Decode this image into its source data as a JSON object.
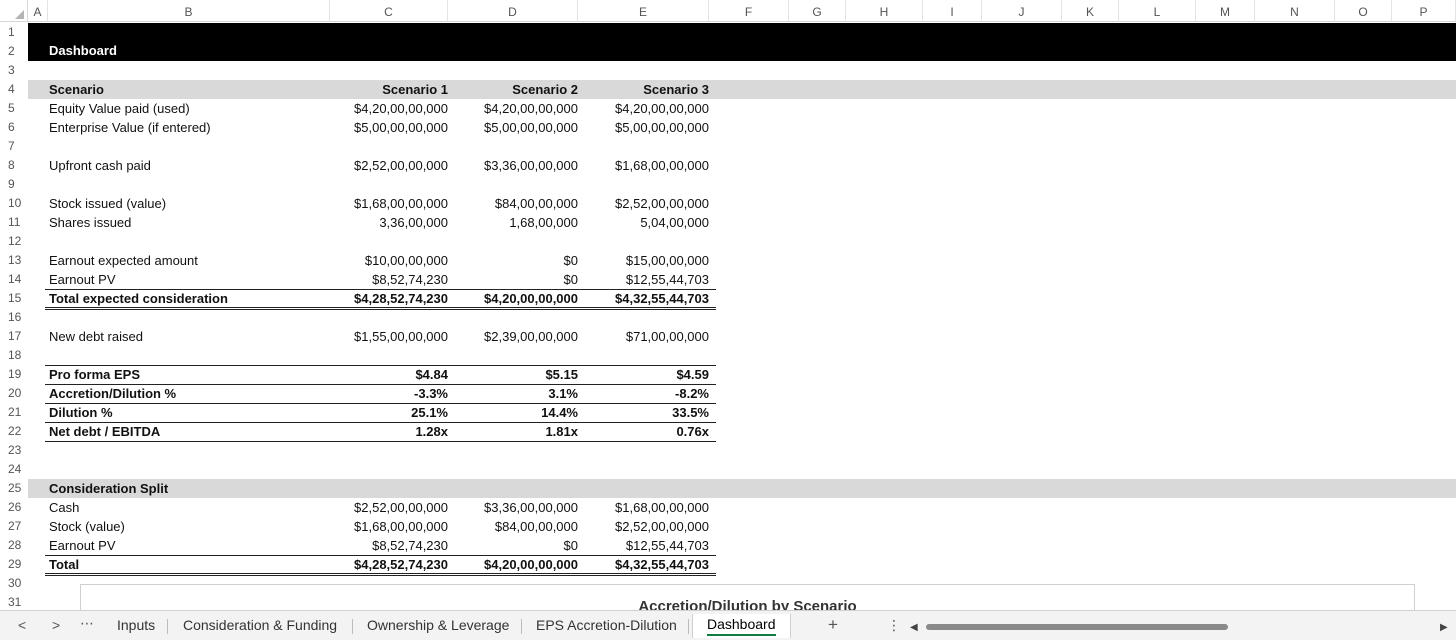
{
  "columns": [
    "A",
    "B",
    "C",
    "D",
    "E",
    "F",
    "G",
    "H",
    "I",
    "J",
    "K",
    "L",
    "M",
    "N",
    "O",
    "P"
  ],
  "title": "Dashboard",
  "rows": [
    {
      "n": "1"
    },
    {
      "n": "2",
      "style": "black",
      "label": "Dashboard"
    },
    {
      "n": "3"
    },
    {
      "n": "4",
      "style": "grey",
      "bold": true,
      "label": "Scenario",
      "c": "Scenario 1",
      "d": "Scenario 2",
      "e": "Scenario 3"
    },
    {
      "n": "5",
      "label": "Equity Value paid (used)",
      "c": "$4,20,00,00,000",
      "d": "$4,20,00,00,000",
      "e": "$4,20,00,00,000"
    },
    {
      "n": "6",
      "label": "Enterprise Value (if entered)",
      "c": "$5,00,00,00,000",
      "d": "$5,00,00,00,000",
      "e": "$5,00,00,00,000"
    },
    {
      "n": "7"
    },
    {
      "n": "8",
      "label": "Upfront cash paid",
      "c": "$2,52,00,00,000",
      "d": "$3,36,00,00,000",
      "e": "$1,68,00,00,000"
    },
    {
      "n": "9"
    },
    {
      "n": "10",
      "label": "Stock issued (value)",
      "c": "$1,68,00,00,000",
      "d": "$84,00,00,000",
      "e": "$2,52,00,00,000"
    },
    {
      "n": "11",
      "label": "Shares issued",
      "c": "3,36,00,000",
      "d": "1,68,00,000",
      "e": "5,04,00,000"
    },
    {
      "n": "12"
    },
    {
      "n": "13",
      "label": "Earnout expected amount",
      "c": "$10,00,00,000",
      "d": "$0",
      "e": "$15,00,00,000"
    },
    {
      "n": "14",
      "label": "Earnout PV",
      "c": "$8,52,74,230",
      "d": "$0",
      "e": "$12,55,44,703"
    },
    {
      "n": "15",
      "bold": true,
      "label": "Total expected consideration",
      "c": "$4,28,52,74,230",
      "d": "$4,20,00,00,000",
      "e": "$4,32,55,44,703"
    },
    {
      "n": "16"
    },
    {
      "n": "17",
      "label": "New debt raised",
      "c": "$1,55,00,00,000",
      "d": "$2,39,00,00,000",
      "e": "$71,00,00,000"
    },
    {
      "n": "18"
    },
    {
      "n": "19",
      "bold": true,
      "label": "Pro forma EPS",
      "c": "$4.84",
      "d": "$5.15",
      "e": "$4.59"
    },
    {
      "n": "20",
      "bold": true,
      "label": "Accretion/Dilution %",
      "c": "-3.3%",
      "d": "3.1%",
      "e": "-8.2%"
    },
    {
      "n": "21",
      "bold": true,
      "label": "Dilution %",
      "c": "25.1%",
      "d": "14.4%",
      "e": "33.5%"
    },
    {
      "n": "22",
      "bold": true,
      "label": "Net debt / EBITDA",
      "c": "1.28x",
      "d": "1.81x",
      "e": "0.76x"
    },
    {
      "n": "23"
    },
    {
      "n": "24"
    },
    {
      "n": "25",
      "style": "grey",
      "bold": true,
      "label": "Consideration Split"
    },
    {
      "n": "26",
      "label": "Cash",
      "c": "$2,52,00,00,000",
      "d": "$3,36,00,00,000",
      "e": "$1,68,00,00,000"
    },
    {
      "n": "27",
      "label": "Stock (value)",
      "c": "$1,68,00,00,000",
      "d": "$84,00,00,000",
      "e": "$2,52,00,00,000"
    },
    {
      "n": "28",
      "label": "Earnout PV",
      "c": "$8,52,74,230",
      "d": "$0",
      "e": "$12,55,44,703"
    },
    {
      "n": "29",
      "bold": true,
      "label": "Total",
      "c": "$4,28,52,74,230",
      "d": "$4,20,00,00,000",
      "e": "$4,32,55,44,703"
    },
    {
      "n": "30"
    },
    {
      "n": "31"
    }
  ],
  "chart": {
    "title": "Accretion/Dilution by Scenario"
  },
  "tabs": {
    "prev": "<",
    "next": ">",
    "more": "⋯",
    "items": [
      "Inputs",
      "Consideration & Funding",
      "Ownership & Leverage",
      "EPS Accretion-Dilution",
      "Dashboard"
    ],
    "active": "Dashboard",
    "add": "+",
    "options": "⋮"
  }
}
